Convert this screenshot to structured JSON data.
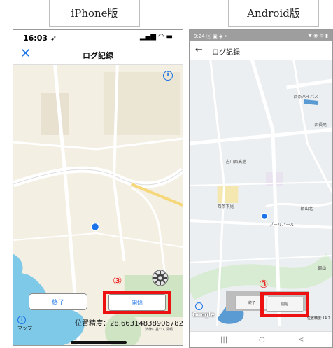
{
  "labels": {
    "ios": "iPhone版",
    "android": "Android版"
  },
  "ios": {
    "time": "16:03 ➶",
    "signal": "▂▄▆ ◠ ▬",
    "close_icon": "close-icon",
    "close_glyph": "✕",
    "title": "ログ記録",
    "info_glyph": "i",
    "end_label": "終了",
    "start_label": "開始",
    "step_marker": "③",
    "accuracy": "位置精度：28.66314838906782",
    "legal": "法律に基づく情報",
    "maps_label": "マップ",
    "colors": {
      "accent": "#1a73e8",
      "highlight": "#ee1111",
      "map_bg": "#f3efe2",
      "water": "#7ec8e8",
      "park": "#cfe4c3"
    }
  },
  "android": {
    "time": "9:24 ⓐ ▣ ◈ •",
    "signal": "✱ ◉ ᯤ ▮",
    "back_glyph": "←",
    "title": "ログ記録",
    "end_label": "終了",
    "start_label": "開始",
    "step_marker": "③",
    "google": "Google",
    "accuracy": "位置精度:14.2",
    "nav_recent": "|||",
    "nav_home": "○",
    "nav_back": "<",
    "map_labels": [
      "吉川西高速",
      "西長尾",
      "西条下見",
      "プールパール",
      "鋼山北",
      "鋼山",
      "西条バイパス"
    ],
    "colors": {
      "map_bg": "#eceff1",
      "road": "#ffffff",
      "water": "#5a9bd3",
      "park": "#d7ecd2"
    }
  }
}
